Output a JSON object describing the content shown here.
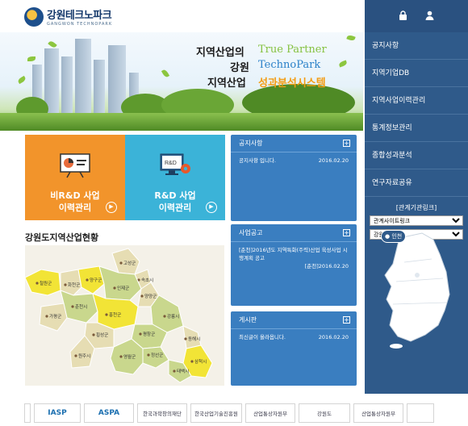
{
  "header": {
    "logo_ko": "강원테크노파크",
    "logo_en": "GANGWON TECHNOPARK"
  },
  "hero": {
    "line1": "지역산업의",
    "line1_en": "True Partner",
    "line2": "강원",
    "line2_en": "TechnoPark",
    "line3": "지역산업",
    "line3_accent": "성과분석시스템"
  },
  "sidebar": {
    "util_icons": [
      "lock-icon",
      "user-icon"
    ],
    "menu": [
      {
        "label": "공지사항"
      },
      {
        "label": "지역기업DB"
      },
      {
        "label": "지역사업이력관리"
      },
      {
        "label": "통계정보관리"
      },
      {
        "label": "종합성과분석"
      },
      {
        "label": "연구자료공유"
      }
    ],
    "related_title": "[관계기관링크]",
    "select_site": "관계사이트링크",
    "select_region": "강원도 시/군",
    "map_badge": "인천"
  },
  "tiles": {
    "nonrd_line1": "비R&D 사업",
    "nonrd_line2": "이력관리",
    "rd_line1": "R&D 사업",
    "rd_line2": "이력관리",
    "rd_icon_text": "R&D"
  },
  "map_section": {
    "title": "강원도지역산업현황",
    "regions": [
      {
        "name": "철원군",
        "highlight": true
      },
      {
        "name": "화천군",
        "highlight": false
      },
      {
        "name": "양구군",
        "highlight": true
      },
      {
        "name": "고성군",
        "highlight": false
      },
      {
        "name": "속초시",
        "highlight": false
      },
      {
        "name": "인제군",
        "highlight": false
      },
      {
        "name": "양양군",
        "highlight": false
      },
      {
        "name": "춘천시",
        "highlight": false
      },
      {
        "name": "홍천군",
        "highlight": true
      },
      {
        "name": "강릉시",
        "highlight": false
      },
      {
        "name": "가평군",
        "highlight": false
      },
      {
        "name": "횡성군",
        "highlight": false
      },
      {
        "name": "평창군",
        "highlight": false
      },
      {
        "name": "동해시",
        "highlight": false
      },
      {
        "name": "원주시",
        "highlight": false
      },
      {
        "name": "정선군",
        "highlight": false
      },
      {
        "name": "삼척시",
        "highlight": true
      },
      {
        "name": "영월군",
        "highlight": false
      },
      {
        "name": "태백시",
        "highlight": false
      }
    ]
  },
  "boards": {
    "notice": {
      "title": "공지사항",
      "items": [
        {
          "text": "공지사항 입니다.",
          "date": "2016.02.20"
        }
      ]
    },
    "biz": {
      "title": "사업공고",
      "items": [
        {
          "text": "[춘천]2016년도 지역특화(주력)산업 육성사업 시행계획 공고",
          "date": "[춘천]2016.02.20"
        }
      ]
    },
    "free": {
      "title": "게시판",
      "items": [
        {
          "text": "최신글이 올라옵니다.",
          "date": "2016.02.20"
        }
      ]
    }
  },
  "footer": {
    "links": [
      {
        "label": "IASP",
        "big": true
      },
      {
        "label": "ASPA",
        "big": true
      },
      {
        "label": "한국과학창의재단",
        "big": false
      },
      {
        "label": "한국산업기술진흥원",
        "big": false
      },
      {
        "label": "산업통상자원부",
        "big": false
      },
      {
        "label": "강원도",
        "big": false
      },
      {
        "label": "산업통상자원부",
        "big": false
      },
      {
        "label": "",
        "big": false
      }
    ]
  },
  "colors": {
    "sidebar": "#2f5a8a",
    "tile_orange": "#f2942b",
    "tile_blue": "#3bb3d8",
    "board_blue": "#3a7ec0",
    "map_highlight": "#f2e436",
    "map_olive": "#c9d78d",
    "map_beige": "#e6ddb3"
  }
}
